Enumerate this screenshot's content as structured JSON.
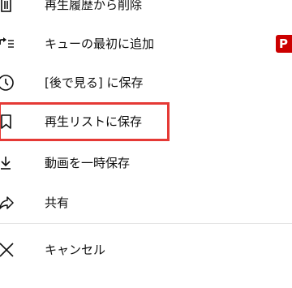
{
  "menu": {
    "items": [
      {
        "icon": "trash-icon",
        "label": "再生履歴から削除"
      },
      {
        "icon": "play-next-queue-icon",
        "label": "キューの最初に追加",
        "badge": "P"
      },
      {
        "icon": "clock-icon",
        "label": "[後で見る] に保存"
      },
      {
        "icon": "bookmark-icon",
        "label": "再生リストに保存",
        "highlighted": true
      },
      {
        "icon": "download-icon",
        "label": "動画を一時保存"
      },
      {
        "icon": "share-icon",
        "label": "共有"
      }
    ],
    "cancel": {
      "icon": "close-icon",
      "label": "キャンセル"
    }
  },
  "colors": {
    "highlight": "#e53935",
    "badge": "#cc0000",
    "divider": "#e5e5e5",
    "text": "#0f0f0f"
  }
}
